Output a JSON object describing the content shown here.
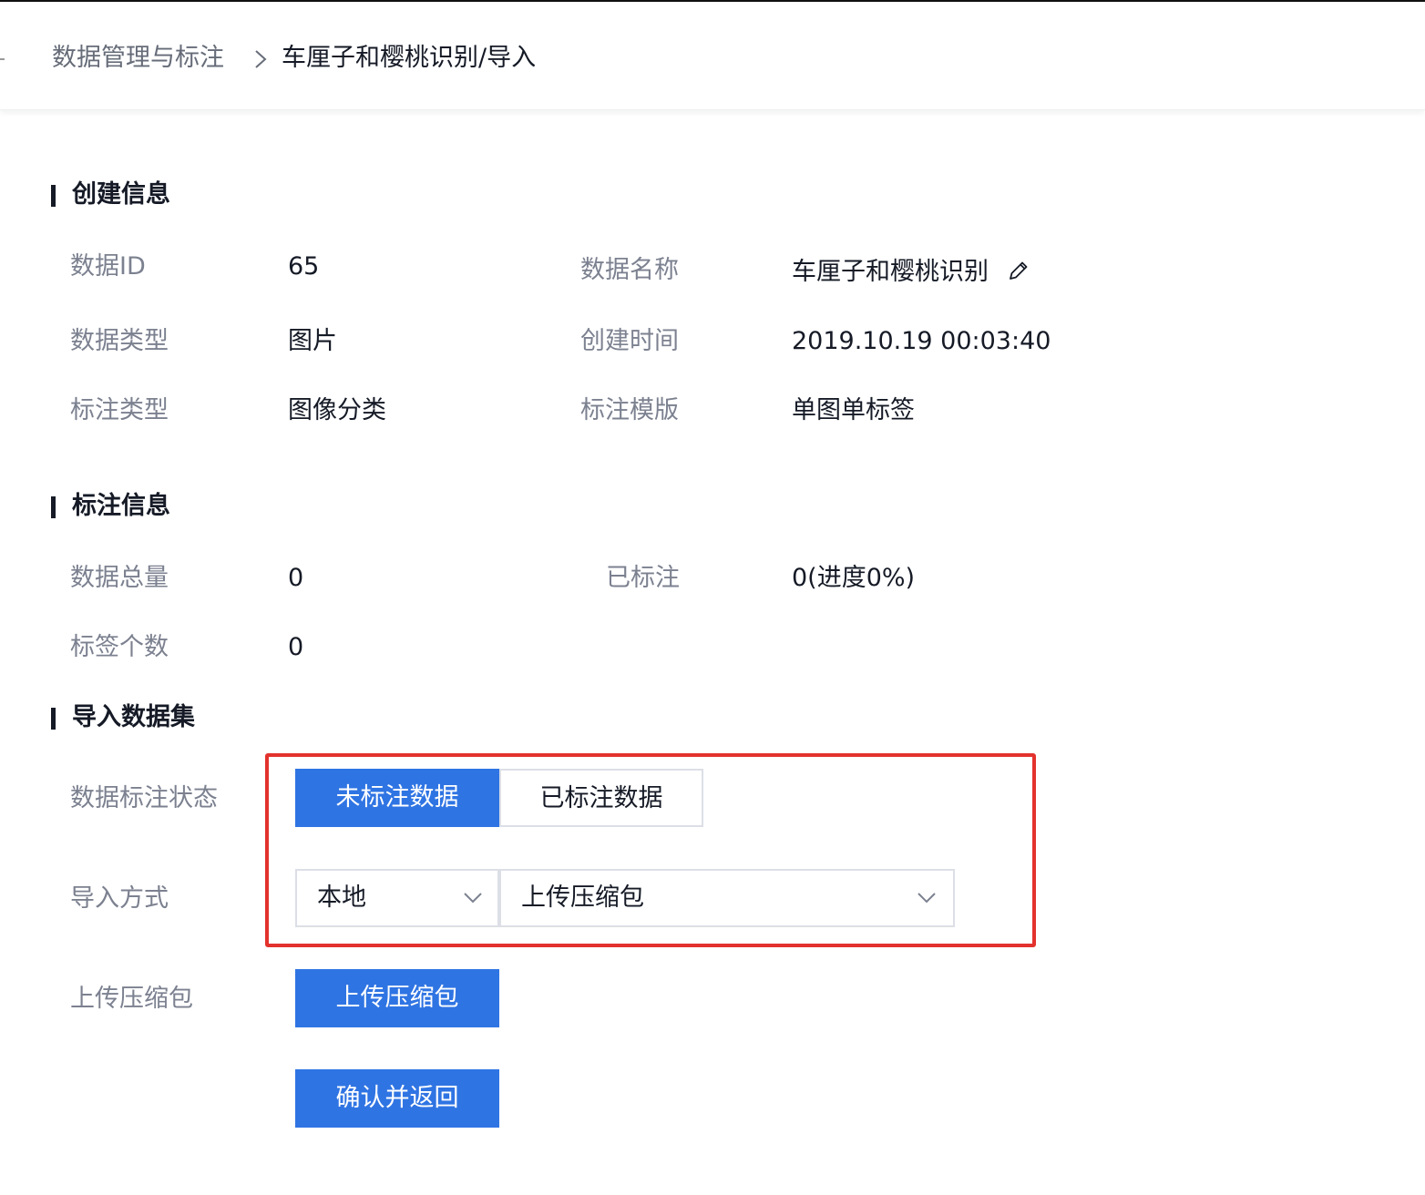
{
  "breadcrumb": {
    "parent": "数据管理与标注",
    "current": "车厘子和樱桃识别/导入"
  },
  "create_info": {
    "title": "创建信息",
    "data_id_label": "数据ID",
    "data_id_value": "65",
    "data_name_label": "数据名称",
    "data_name_value": "车厘子和樱桃识别",
    "data_type_label": "数据类型",
    "data_type_value": "图片",
    "create_time_label": "创建时间",
    "create_time_value": "2019.10.19 00:03:40",
    "annotation_type_label": "标注类型",
    "annotation_type_value": "图像分类",
    "annotation_template_label": "标注模版",
    "annotation_template_value": "单图单标签"
  },
  "annotation_info": {
    "title": "标注信息",
    "total_label": "数据总量",
    "total_value": "0",
    "annotated_label": "已标注",
    "annotated_value": "0(进度0%)",
    "tag_count_label": "标签个数",
    "tag_count_value": "0"
  },
  "import_dataset": {
    "title": "导入数据集",
    "status_label": "数据标注状态",
    "status_options": [
      "未标注数据",
      "已标注数据"
    ],
    "status_selected": "未标注数据",
    "method_label": "导入方式",
    "method_source": "本地",
    "method_type": "上传压缩包",
    "upload_label": "上传压缩包",
    "upload_button": "上传压缩包",
    "confirm_button": "确认并返回"
  },
  "colors": {
    "primary": "#2f74e3",
    "highlight": "#e3322d",
    "label_text": "#7c8190",
    "body_text": "#151a26"
  },
  "icons": {
    "breadcrumb_separator": "chevron-right-icon",
    "edit": "pencil-icon",
    "dropdown": "chevron-down-icon"
  }
}
